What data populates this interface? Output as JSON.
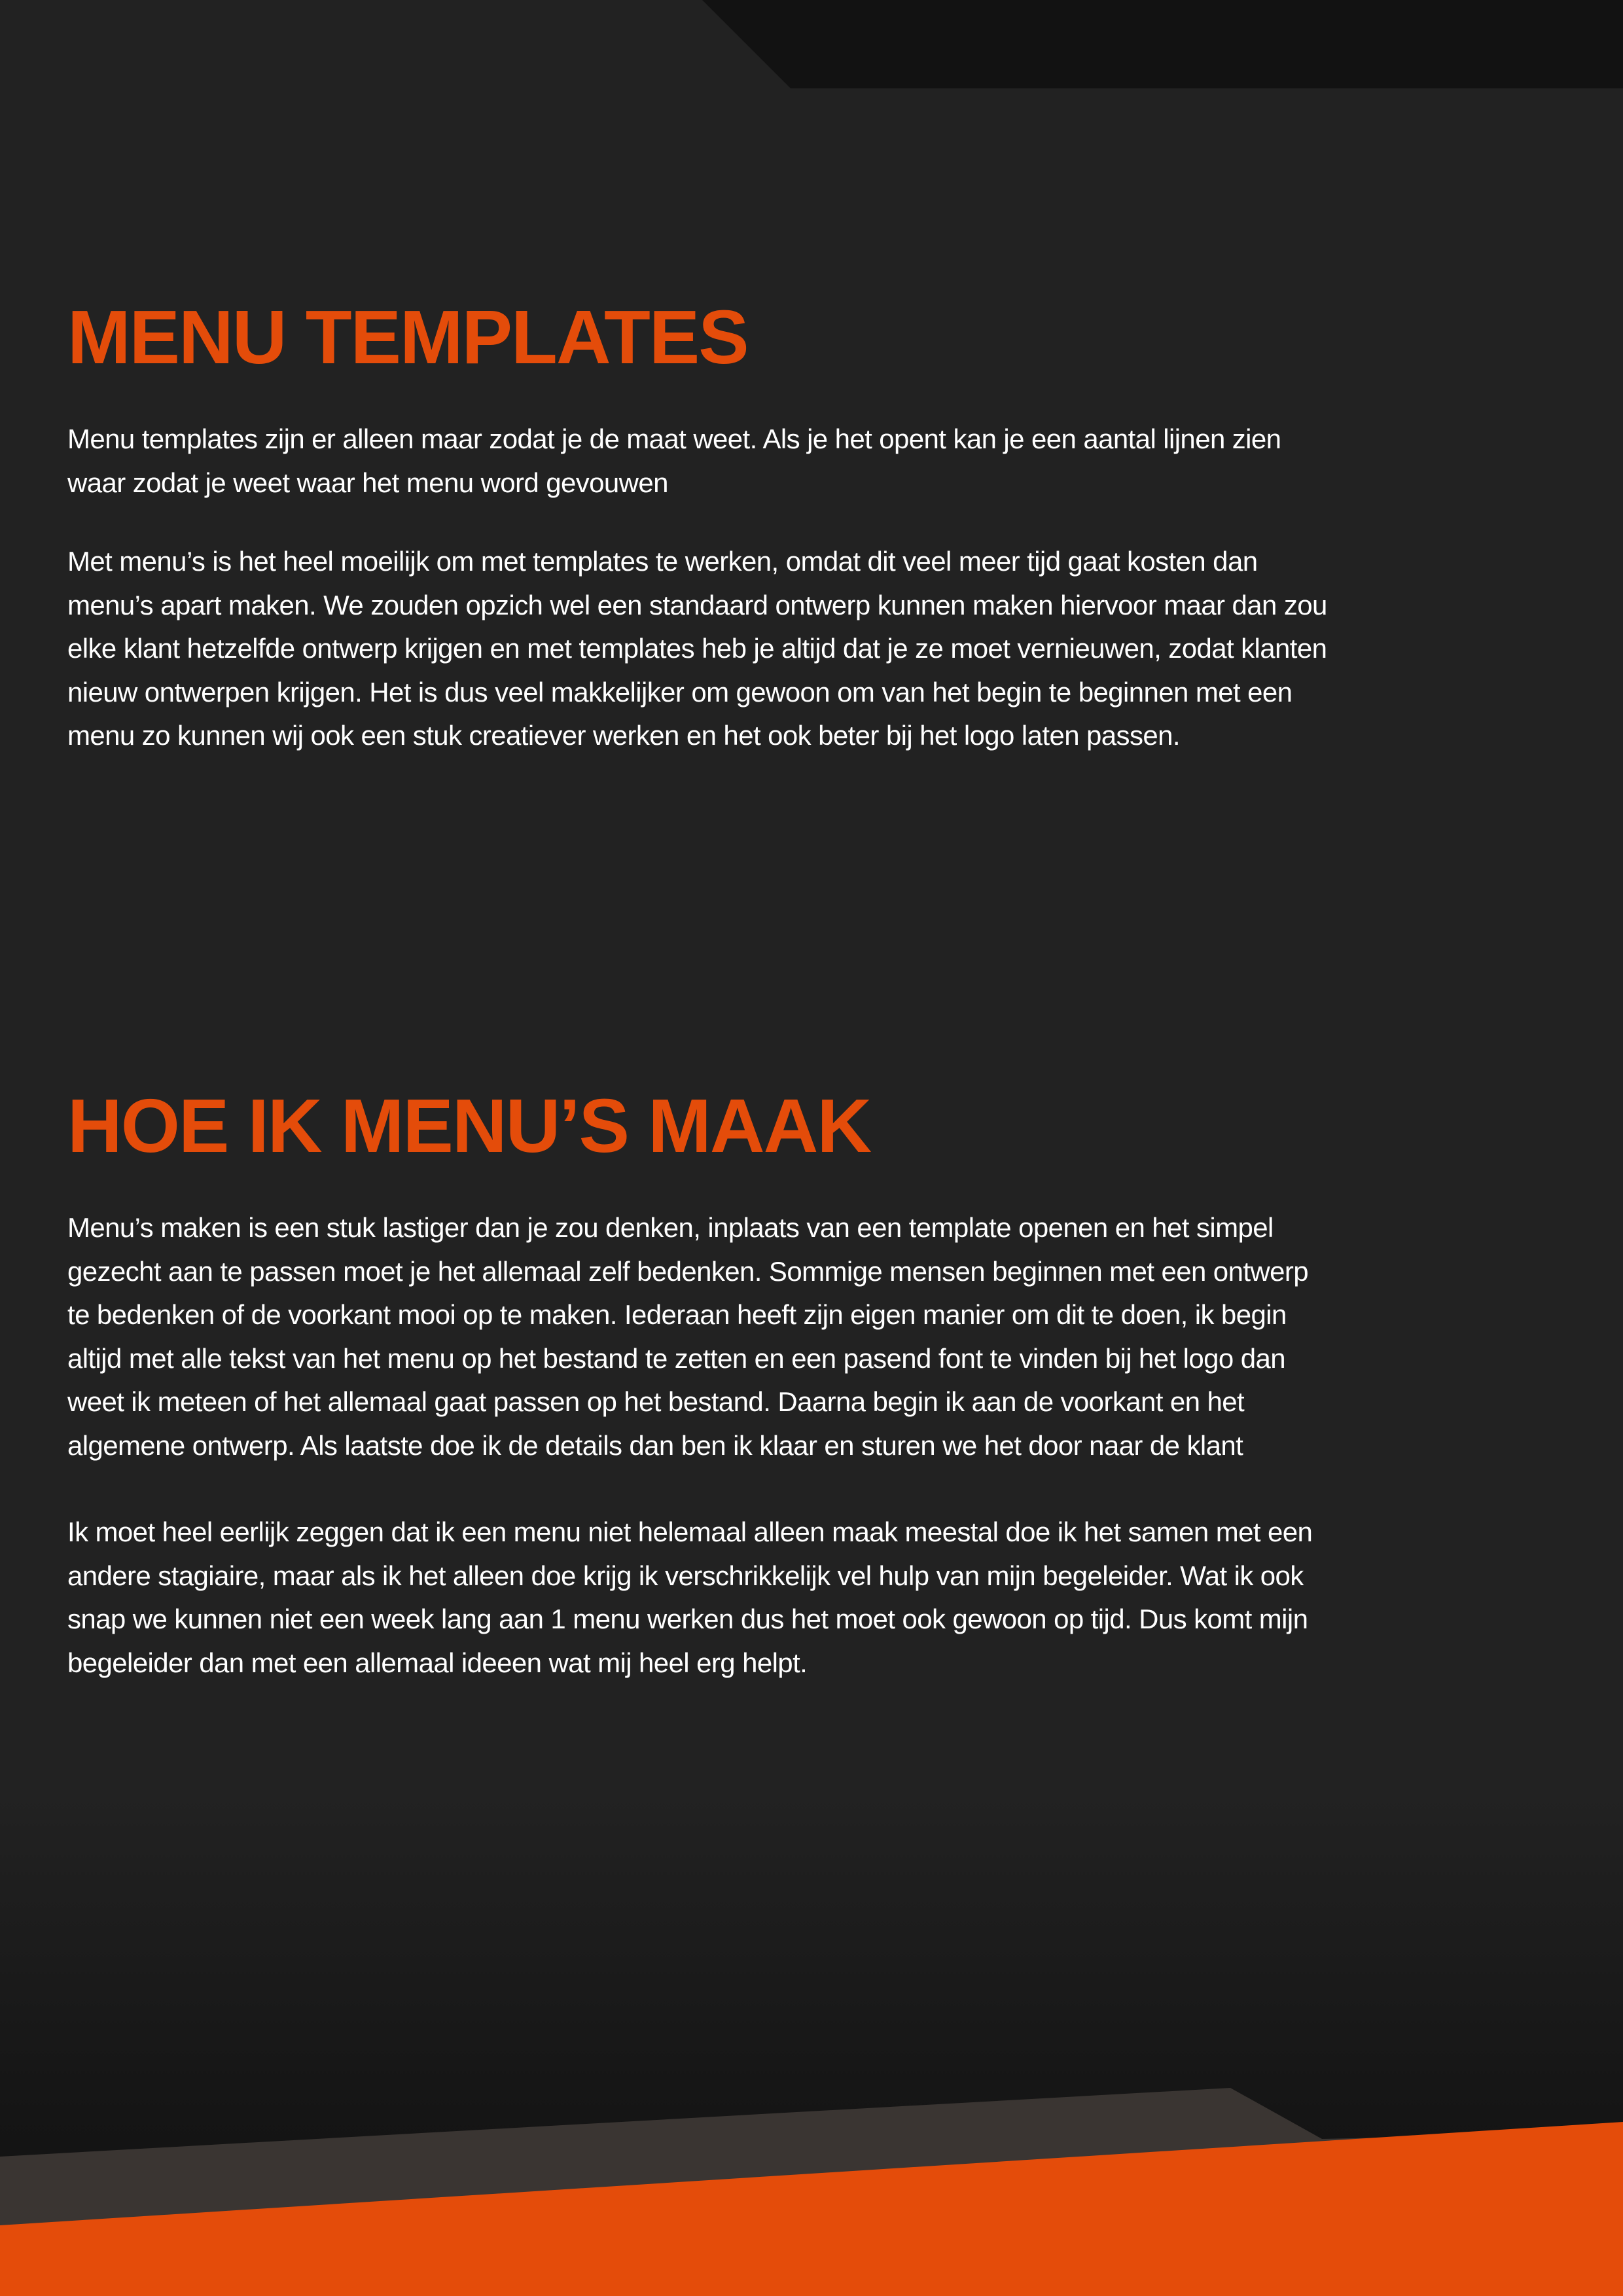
{
  "section_1": {
    "heading": "MENU TEMPLATES",
    "paragraphs": [
      "Menu templates zijn er alleen maar zodat je de maat weet. Als je het opent kan je een aantal lijnen zien waar zodat je weet waar het menu word gevouwen",
      "Met menu’s is het heel moeilijk om met templates te werken, omdat dit veel meer tijd gaat kosten dan menu’s apart maken. We zouden opzich wel een standaard ontwerp kunnen maken hiervoor maar dan zou elke klant hetzelfde ontwerp krijgen en met templates heb je altijd dat je ze moet vernieuwen, zodat klanten nieuw ontwerpen krijgen. Het is dus veel makkelijker om gewoon om van het begin te beginnen met een menu zo kunnen wij ook een stuk creatiever werken en het ook beter bij het logo laten passen."
    ]
  },
  "section_2": {
    "heading": "HOE IK MENU’S MAAK",
    "paragraphs": [
      "Menu’s maken is een stuk lastiger dan je zou denken, inplaats van een template openen en het simpel gezecht aan te passen moet je het allemaal zelf bedenken. Sommige mensen beginnen met een ontwerp te bedenken of de voorkant mooi op te maken. Iederaan heeft zijn eigen manier om dit te doen, ik begin altijd met alle tekst van het menu op het bestand te zetten en een pasend font te vinden bij het logo dan weet ik meteen of het allemaal gaat passen op het bestand. Daarna begin ik aan de voorkant en het algemene ontwerp. Als laatste doe ik de details dan ben ik klaar en sturen we het door naar de klant",
      "Ik moet heel eerlijk zeggen dat ik een menu niet helemaal alleen maak meestal doe ik het samen met een andere stagiaire, maar als ik het alleen doe krijg ik verschrikkelijk vel hulp van mijn begeleider. Wat ik ook snap we kunnen niet een week lang aan 1 menu werken dus het moet ook gewoon op tijd. Dus komt mijn begeleider dan met een allemaal ideeen wat mij heel erg helpt."
    ]
  },
  "colors": {
    "background": "#222222",
    "accent_orange": "#e44c0a",
    "top_band": "#121212",
    "bottom_band_grey": "#3a3532",
    "text": "#ffffff"
  }
}
